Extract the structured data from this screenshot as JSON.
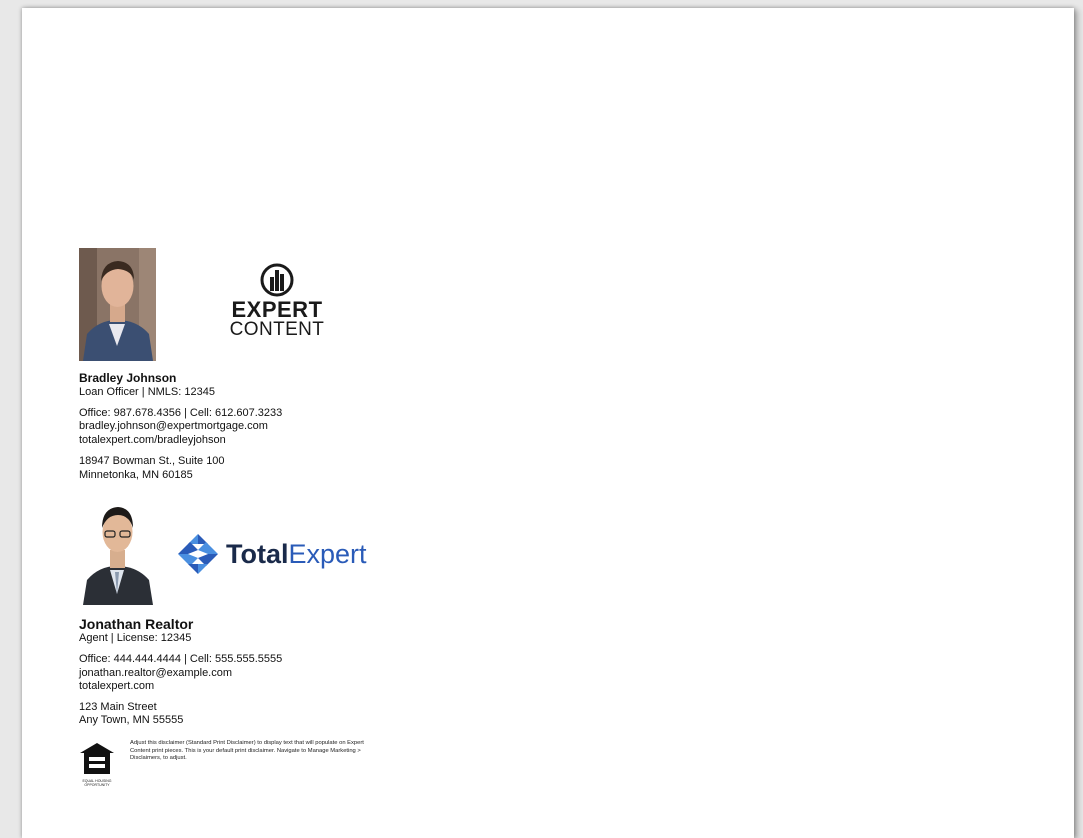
{
  "agent1": {
    "name": "Bradley Johnson",
    "title": "Loan Officer | NMLS: 12345",
    "phones": "Office: 987.678.4356 | Cell: 612.607.3233",
    "email": "bradley.johnson@expertmortgage.com",
    "website": "totalexpert.com/bradleyjohson",
    "address_line1": "18947 Bowman St., Suite 100",
    "address_line2": "Minnetonka, MN 60185",
    "photo_icon": "headshot-man-blue-suit"
  },
  "logo1": {
    "line1": "EXPERT",
    "line2": "CONTENT",
    "icon": "building-globe-icon"
  },
  "agent2": {
    "name": "Jonathan Realtor",
    "title": "Agent | License: 12345",
    "phones": "Office: 444.444.4444 | Cell: 555.555.5555",
    "email": "jonathan.realtor@example.com",
    "website": "totalexpert.com",
    "address_line1": "123 Main Street",
    "address_line2": "Any Town, MN 55555",
    "photo_icon": "headshot-man-glasses"
  },
  "logo2": {
    "word_bold": "Total",
    "word_light": "Expert",
    "icon": "diamond-chevrons-icon",
    "colors": {
      "dark": "#1a2a4a",
      "blue": "#2a5bb8",
      "light_blue": "#4a8fe0"
    }
  },
  "footer": {
    "disclaimer": "Adjust this disclaimer (Standard Print Disclaimer) to display text that will populate on Expert Content print pieces. This is your default print disclaimer. Navigate to Manage Marketing > Disclaimers, to adjust.",
    "eho_icon": "equal-housing-opportunity-icon",
    "eho_caption": "EQUAL HOUSING OPPORTUNITY"
  }
}
